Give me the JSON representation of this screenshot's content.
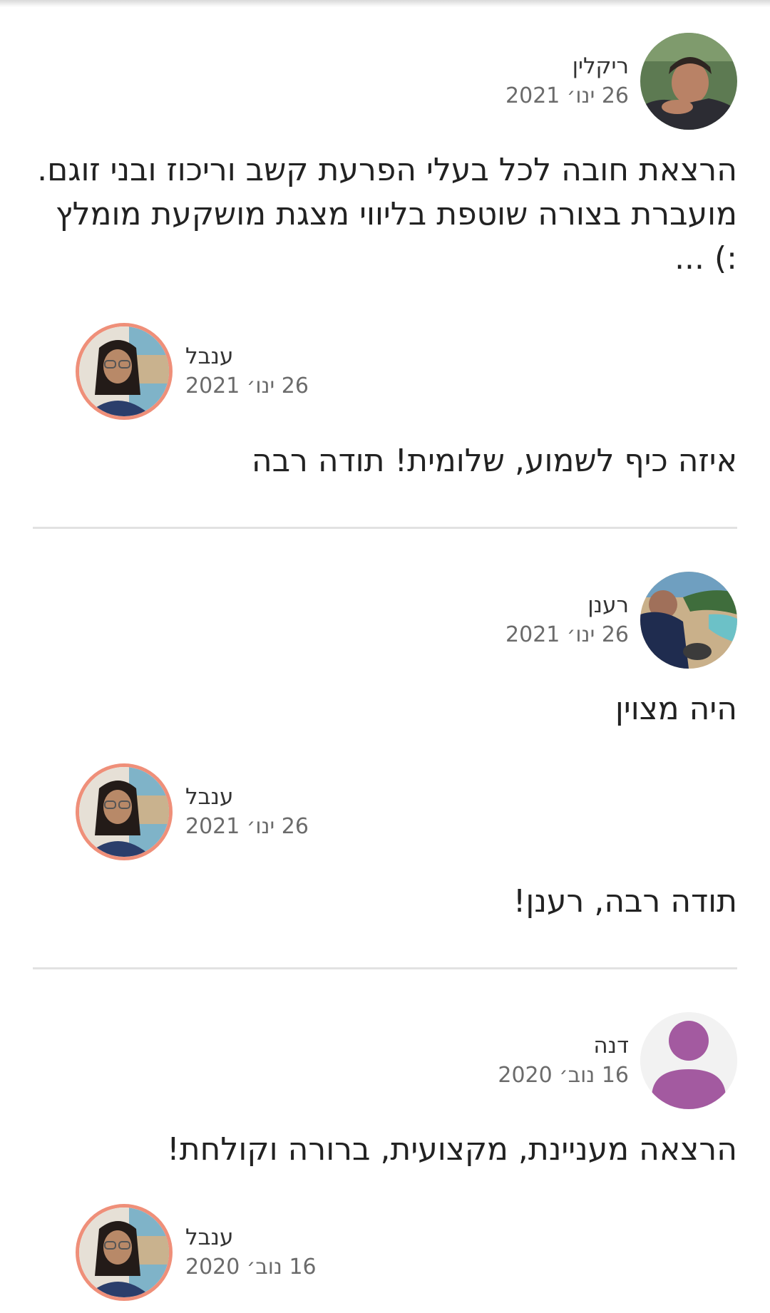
{
  "colors": {
    "reply_ring": "#ef8f79",
    "divider": "#e2e2e2",
    "date_text": "#6b6b6b",
    "default_avatar": "#a35aa0"
  },
  "reviews": [
    {
      "author": "ריקלין",
      "date": "26 ינו׳ 2021",
      "avatar_icon": "user-photo-avatar",
      "text": "הרצאת חובה לכל בעלי הפרעת קשב וריכוז ובני זוגם. מועברת בצורה שוטפת בליווי מצגת מושקעת מומלץ :) ...",
      "reply": {
        "author": "ענבל",
        "date": "26 ינו׳ 2021",
        "text": "איזה כיף לשמוע, שלומית! תודה רבה"
      }
    },
    {
      "author": "רענן",
      "date": "26 ינו׳ 2021",
      "avatar_icon": "user-photo-avatar",
      "text": "היה מצוין",
      "reply": {
        "author": "ענבל",
        "date": "26 ינו׳ 2021",
        "text": "תודה רבה, רענן!"
      }
    },
    {
      "author": "דנה",
      "date": "16 נוב׳ 2020",
      "avatar_icon": "default-person-icon",
      "text": "הרצאה מעניינת, מקצועית, ברורה וקולחת!",
      "reply": {
        "author": "ענבל",
        "date": "16 נוב׳ 2020",
        "text": ""
      }
    }
  ]
}
